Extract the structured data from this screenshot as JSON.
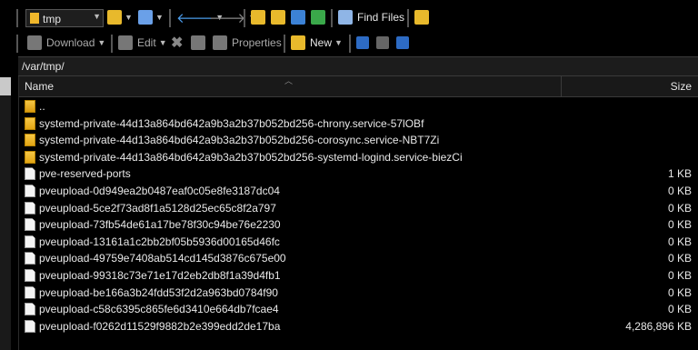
{
  "toolbar1": {
    "drive_combo_value": "tmp",
    "find_files_label": "Find Files",
    "icons": [
      "folder-open-icon",
      "filter-icon",
      "back-icon",
      "forward-icon",
      "parent-dir-icon",
      "root-dir-icon",
      "home-icon",
      "refresh-icon",
      "find-files-icon",
      "tree-toggle-icon"
    ]
  },
  "toolbar2": {
    "download_label": "Download",
    "edit_label": "Edit",
    "properties_label": "Properties",
    "new_label": "New",
    "icons": [
      "download-icon",
      "edit-icon",
      "delete-icon",
      "rename-icon",
      "properties-icon",
      "new-icon",
      "select-all-icon",
      "unselect-icon",
      "filter-icon"
    ]
  },
  "path": "/var/tmp/",
  "columns": {
    "name": "Name",
    "size": "Size"
  },
  "files": [
    {
      "name": "..",
      "size": "",
      "type": "up"
    },
    {
      "name": "systemd-private-44d13a864bd642a9b3a2b37b052bd256-chrony.service-57lOBf",
      "size": "",
      "type": "folder"
    },
    {
      "name": "systemd-private-44d13a864bd642a9b3a2b37b052bd256-corosync.service-NBT7Zi",
      "size": "",
      "type": "folder"
    },
    {
      "name": "systemd-private-44d13a864bd642a9b3a2b37b052bd256-systemd-logind.service-biezCi",
      "size": "",
      "type": "folder"
    },
    {
      "name": "pve-reserved-ports",
      "size": "1 KB",
      "type": "file"
    },
    {
      "name": "pveupload-0d949ea2b0487eaf0c05e8fe3187dc04",
      "size": "0 KB",
      "type": "file"
    },
    {
      "name": "pveupload-5ce2f73ad8f1a5128d25ec65c8f2a797",
      "size": "0 KB",
      "type": "file"
    },
    {
      "name": "pveupload-73fb54de61a17be78f30c94be76e2230",
      "size": "0 KB",
      "type": "file"
    },
    {
      "name": "pveupload-13161a1c2bb2bf05b5936d00165d46fc",
      "size": "0 KB",
      "type": "file"
    },
    {
      "name": "pveupload-49759e7408ab514cd145d3876c675e00",
      "size": "0 KB",
      "type": "file"
    },
    {
      "name": "pveupload-99318c73e71e17d2eb2db8f1a39d4fb1",
      "size": "0 KB",
      "type": "file"
    },
    {
      "name": "pveupload-be166a3b24fdd53f2d2a963bd0784f90",
      "size": "0 KB",
      "type": "file"
    },
    {
      "name": "pveupload-c58c6395c865fe6d3410e664db7fcae4",
      "size": "0 KB",
      "type": "file"
    },
    {
      "name": "pveupload-f0262d11529f9882b2e399edd2de17ba",
      "size": "4,286,896 KB",
      "type": "file"
    }
  ]
}
